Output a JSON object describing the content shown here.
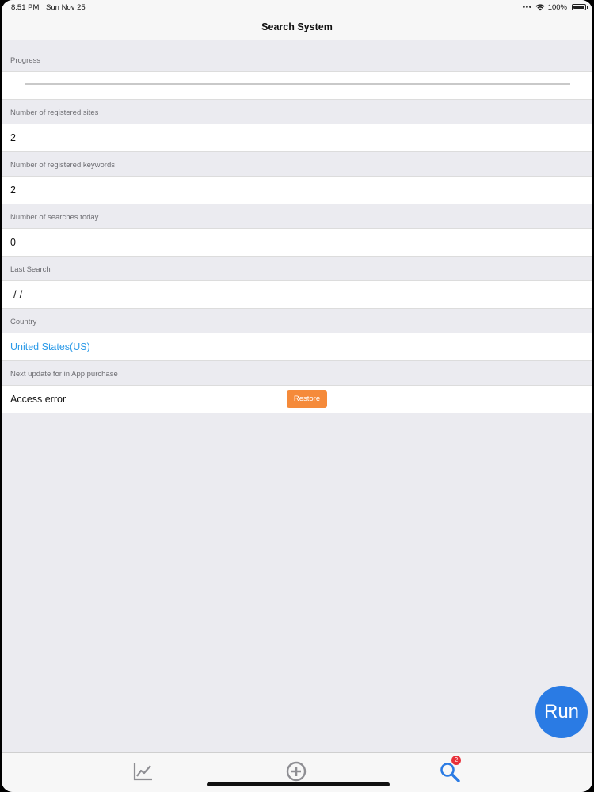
{
  "status_bar": {
    "time": "8:51 PM",
    "date": "Sun Nov 25",
    "battery": "100%"
  },
  "nav": {
    "title": "Search System"
  },
  "sections": {
    "progress": {
      "header": "Progress",
      "value": 0.0
    },
    "sites": {
      "header": "Number of registered sites",
      "value": "2"
    },
    "keywords": {
      "header": "Number of registered keywords",
      "value": "2"
    },
    "searches": {
      "header": "Number of searches today",
      "value": "0"
    },
    "last_search": {
      "header": "Last Search",
      "value": "-/-/-  -"
    },
    "country": {
      "header": "Country",
      "value": "United States(US)"
    },
    "update": {
      "header": "Next update for in App purchase",
      "value": "Access error",
      "restore_label": "Restore"
    }
  },
  "run_button": {
    "label": "Run"
  },
  "tab_bar": {
    "items": [
      {
        "icon": "chart-icon"
      },
      {
        "icon": "add-circle-icon"
      },
      {
        "icon": "search-icon",
        "badge": "2",
        "selected": true
      }
    ]
  },
  "colors": {
    "accent": "#2a7be4",
    "link": "#2d9be8",
    "restore": "#f58a3a",
    "badge": "#e8303a"
  }
}
